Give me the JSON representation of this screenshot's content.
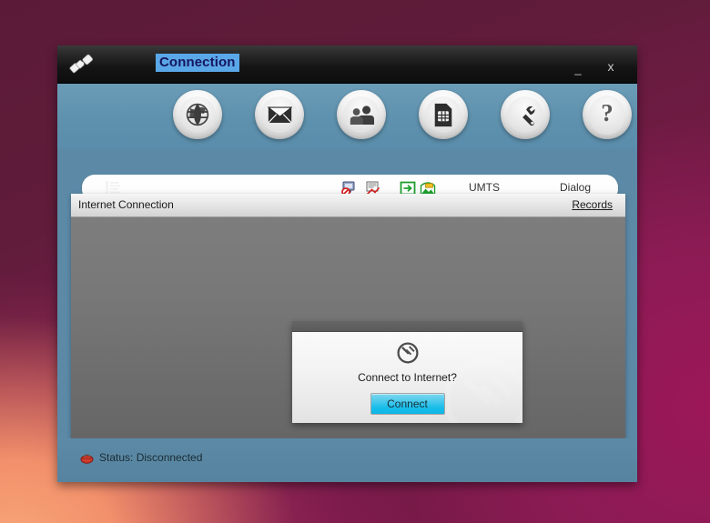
{
  "window": {
    "title": "Connection",
    "app_icon": "plug-connector-icon",
    "controls": {
      "minimize_label": "_",
      "close_label": "x"
    }
  },
  "toolbar": {
    "buttons": [
      {
        "name": "internet",
        "icon": "globe-icon",
        "label": ""
      },
      {
        "name": "mail",
        "icon": "envelope-icon",
        "label": ""
      },
      {
        "name": "contacts",
        "icon": "people-icon",
        "label": ""
      },
      {
        "name": "sim",
        "icon": "sim-card-icon",
        "label": ""
      },
      {
        "name": "tools",
        "icon": "tools-icon",
        "label": ""
      },
      {
        "name": "help",
        "icon": "question-mark-icon",
        "label": "?"
      }
    ]
  },
  "info_strip": {
    "signal_icon": "signal-tower-icon",
    "status_icons": [
      {
        "name": "screen-blocked-icon"
      },
      {
        "name": "mail-blocked-icon"
      },
      {
        "name": "login-enter-icon"
      },
      {
        "name": "picture-icon"
      }
    ],
    "network_label": "UMTS",
    "mode_label": "Dialog"
  },
  "panel": {
    "title": "Internet Connection",
    "records_link": "Records"
  },
  "dialog": {
    "plug_icon": "plug-icon",
    "question": "Connect to Internet?",
    "connect_button": "Connect"
  },
  "status_bar": {
    "icon": "disconnected-indicator-icon",
    "text": "Status: Disconnected"
  },
  "colors": {
    "title_highlight": "#5aa7e8",
    "connect_button": "#17bdea",
    "toolbar_blue": "#5e91ad",
    "panel_gray": "#6d6d6d"
  }
}
